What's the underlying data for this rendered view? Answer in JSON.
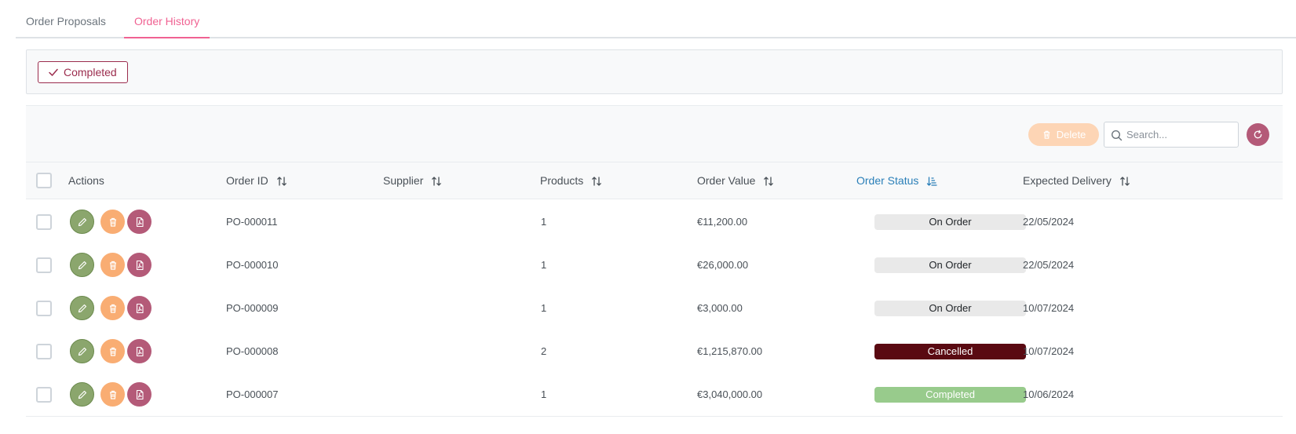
{
  "tabs": [
    {
      "label": "Order Proposals",
      "active": false
    },
    {
      "label": "Order History",
      "active": true
    }
  ],
  "filter": {
    "completed_label": "Completed"
  },
  "toolbar": {
    "delete_label": "Delete",
    "search_placeholder": "Search..."
  },
  "columns": {
    "actions": "Actions",
    "order_id": "Order ID",
    "supplier": "Supplier",
    "products": "Products",
    "order_value": "Order Value",
    "order_status": "Order Status",
    "expected_delivery": "Expected Delivery"
  },
  "rows": [
    {
      "order_id": "PO-000011",
      "supplier": "",
      "products": "1",
      "order_value": "€11,200.00",
      "status": "On Order",
      "status_kind": "onorder",
      "delivery": "22/05/2024"
    },
    {
      "order_id": "PO-000010",
      "supplier": "",
      "products": "1",
      "order_value": "€26,000.00",
      "status": "On Order",
      "status_kind": "onorder",
      "delivery": "22/05/2024"
    },
    {
      "order_id": "PO-000009",
      "supplier": "",
      "products": "1",
      "order_value": "€3,000.00",
      "status": "On Order",
      "status_kind": "onorder",
      "delivery": "10/07/2024"
    },
    {
      "order_id": "PO-000008",
      "supplier": "",
      "products": "2",
      "order_value": "€1,215,870.00",
      "status": "Cancelled",
      "status_kind": "cancelled",
      "delivery": "10/07/2024"
    },
    {
      "order_id": "PO-000007",
      "supplier": "",
      "products": "1",
      "order_value": "€3,040,000.00",
      "status": "Completed",
      "status_kind": "completed",
      "delivery": "10/06/2024"
    }
  ],
  "colors": {
    "accent": "#f06292",
    "brand": "#9b2c4d",
    "edit": "#8ba66d",
    "delete": "#f9ad73",
    "pdf": "#b45a78",
    "sorted_column": "#2a7fb8",
    "cancelled": "#5a0a12",
    "completed": "#98cb8c",
    "on_order": "#e9e9e9"
  },
  "icons": {
    "check": "check-icon",
    "trash": "trash-icon",
    "search": "search-icon",
    "refresh": "refresh-icon",
    "sort": "sort-icon",
    "sort_active": "sort-amount-down-icon",
    "edit": "pencil-icon",
    "pdf": "file-pdf-icon"
  }
}
